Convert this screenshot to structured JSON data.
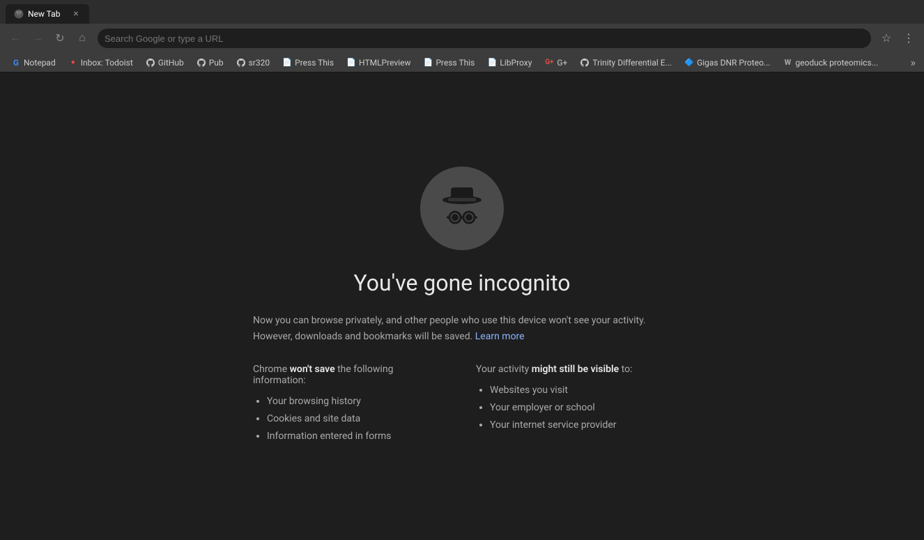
{
  "browser": {
    "tab": {
      "label": "New Tab",
      "active": true
    },
    "address": {
      "value": "",
      "placeholder": "Search Google or type a URL"
    },
    "toolbar": {
      "back_title": "Back",
      "forward_title": "Forward",
      "reload_title": "Reload",
      "home_title": "Home",
      "star_title": "Bookmark this tab",
      "menu_title": "Customize and control Google Chrome"
    }
  },
  "bookmarks": {
    "items": [
      {
        "id": "notepad",
        "label": "Notepad",
        "icon": "G",
        "icon_type": "g"
      },
      {
        "id": "todoist",
        "label": "Inbox: Todoist",
        "icon": "T",
        "icon_type": "red"
      },
      {
        "id": "github1",
        "label": "GitHub",
        "icon": "⌥",
        "icon_type": "gh"
      },
      {
        "id": "pub",
        "label": "Pub",
        "icon": "⌥",
        "icon_type": "gh"
      },
      {
        "id": "sr320",
        "label": "sr320",
        "icon": "⌥",
        "icon_type": "gh"
      },
      {
        "id": "pressthis1",
        "label": "Press This",
        "icon": "📄",
        "icon_type": "doc"
      },
      {
        "id": "htmlpreview",
        "label": "HTMLPreview",
        "icon": "📄",
        "icon_type": "doc"
      },
      {
        "id": "pressthis2",
        "label": "Press This",
        "icon": "📄",
        "icon_type": "doc"
      },
      {
        "id": "libproxy",
        "label": "LibProxy",
        "icon": "📄",
        "icon_type": "doc"
      },
      {
        "id": "gplus",
        "label": "G+",
        "icon": "G+",
        "icon_type": "gplus"
      },
      {
        "id": "trinity",
        "label": "Trinity Differential E...",
        "icon": "⌥",
        "icon_type": "gh"
      },
      {
        "id": "gigas",
        "label": "Gigas DNR Proteo...",
        "icon": "🔷",
        "icon_type": "blue"
      },
      {
        "id": "geoduck",
        "label": "geoduck proteomics...",
        "icon": "W",
        "icon_type": "wiki"
      }
    ],
    "more_label": "»"
  },
  "incognito": {
    "title": "You've gone incognito",
    "description_before_link": "Now you can browse privately, and other people who use this device won't see your activity. However, downloads and bookmarks will be saved.",
    "learn_more_label": "Learn more",
    "learn_more_url": "#",
    "chrome_wont_save_prefix": "Chrome ",
    "chrome_wont_save_bold": "won't save",
    "chrome_wont_save_suffix": " the following information:",
    "your_activity_prefix": "Your activity ",
    "your_activity_bold": "might still be visible",
    "your_activity_suffix": " to:",
    "wont_save_items": [
      "Your browsing history",
      "Cookies and site data",
      "Information entered in forms"
    ],
    "still_visible_items": [
      "Websites you visit",
      "Your employer or school",
      "Your internet service provider"
    ]
  }
}
